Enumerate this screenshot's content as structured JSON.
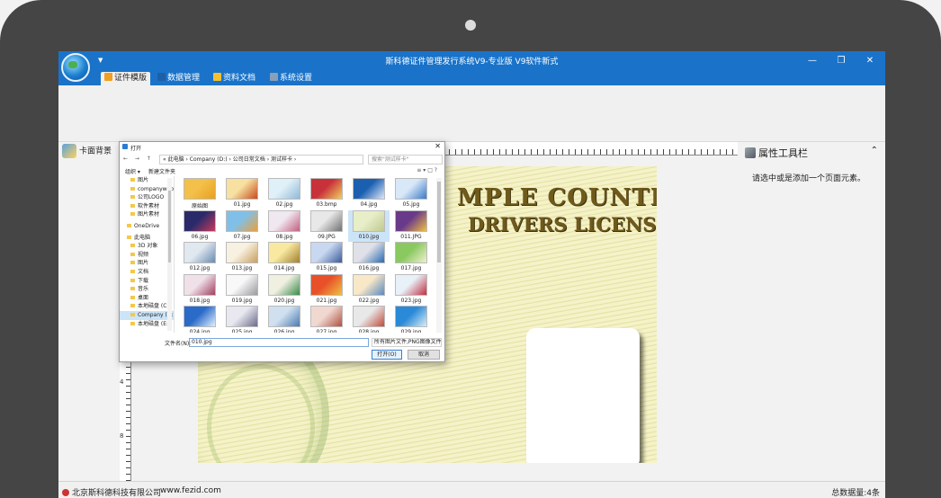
{
  "app": {
    "title": "斯科德证件管理发行系统V9-专业版    V9软件新式",
    "window_controls": {
      "minimize": "—",
      "restore": "❐",
      "close": "✕"
    }
  },
  "ribbon": {
    "tabs": [
      {
        "label": "证件模版",
        "color": "#f0a020"
      },
      {
        "label": "数据管理",
        "color": "#1e5fa8"
      },
      {
        "label": "资料文档",
        "color": "#f5c030"
      },
      {
        "label": "系统设置",
        "color": "#8aa0b8"
      }
    ],
    "orb_arrow": "▼"
  },
  "left_panel": {
    "card_background_label": "卡面背景"
  },
  "canvas": {
    "card_title_1": "MPLE COUNTRY",
    "card_title_2": "DRIVERS LICENSE",
    "ruler_v_labels": [
      "4",
      "8"
    ],
    "more_dots": "⋮"
  },
  "props_panel": {
    "title": "属性工具栏",
    "collapse": "⌃",
    "hint": "请选中或是添加一个页面元素。"
  },
  "statusbar": {
    "company": "北京斯科德科技有限公司",
    "url": "www.fezid.com",
    "count": "总数据量:4条"
  },
  "dialog": {
    "title": "打开",
    "close": "✕",
    "nav": "← → ↑",
    "address": "« 此电脑  ›  Company (D:)  ›  公司日常文档  ›  测试样卡  ›",
    "search_placeholder": "搜索\"测试样卡\"",
    "organize": "组织 ▾",
    "new_folder": "新建文件夹",
    "view": "≡ ▾  □  ?",
    "sidebar": [
      {
        "label": "图片",
        "cls": "l1"
      },
      {
        "label": "companyweb",
        "cls": "l1"
      },
      {
        "label": "公司LOGO",
        "cls": "l1"
      },
      {
        "label": "软件素材",
        "cls": "l1"
      },
      {
        "label": "图片素材",
        "cls": "l1"
      },
      {
        "label": "OneDrive",
        "cls": "gap"
      },
      {
        "label": "此电脑",
        "cls": "gap"
      },
      {
        "label": "3D 对象",
        "cls": "l1"
      },
      {
        "label": "视频",
        "cls": "l1"
      },
      {
        "label": "图片",
        "cls": "l1"
      },
      {
        "label": "文档",
        "cls": "l1"
      },
      {
        "label": "下载",
        "cls": "l1"
      },
      {
        "label": "音乐",
        "cls": "l1"
      },
      {
        "label": "桌面",
        "cls": "l1"
      },
      {
        "label": "本地磁盘 (C:)",
        "cls": "l1"
      },
      {
        "label": "Company (D:)",
        "cls": "l1 sel"
      },
      {
        "label": "本地磁盘 (E:)",
        "cls": "l1"
      }
    ],
    "files": [
      {
        "name": "原始图",
        "c1": "#f3c04a",
        "c2": "#e8a020"
      },
      {
        "name": "01.jpg",
        "c1": "#f7e0a0",
        "c2": "#c84a1e"
      },
      {
        "name": "02.jpg",
        "c1": "#e0f0f8",
        "c2": "#90b8d8"
      },
      {
        "name": "03.bmp",
        "c1": "#c8303a",
        "c2": "#f0d060"
      },
      {
        "name": "04.jpg",
        "c1": "#1a5fb0",
        "c2": "#e0e8f8"
      },
      {
        "name": "05.jpg",
        "c1": "#d8e8f8",
        "c2": "#3a7ac8"
      },
      {
        "name": "06.jpg",
        "c1": "#2a2a6a",
        "c2": "#c83a5a"
      },
      {
        "name": "07.jpg",
        "c1": "#80c0e8",
        "c2": "#e8a040"
      },
      {
        "name": "08.jpg",
        "c1": "#f0e8f0",
        "c2": "#c06080"
      },
      {
        "name": "09.JPG",
        "c1": "#e8e8e8",
        "c2": "#707070"
      },
      {
        "name": "010.jpg",
        "c1": "#e8eec8",
        "c2": "#c0c890"
      },
      {
        "name": "011.JPG",
        "c1": "#6a3a8a",
        "c2": "#f0c040"
      },
      {
        "name": "012.jpg",
        "c1": "#e0e8f0",
        "c2": "#6a8ab0"
      },
      {
        "name": "013.jpg",
        "c1": "#f8f0e0",
        "c2": "#c8a060"
      },
      {
        "name": "014.jpg",
        "c1": "#f8e8a0",
        "c2": "#a08030"
      },
      {
        "name": "015.jpg",
        "c1": "#c8d8f0",
        "c2": "#3a5a9a"
      },
      {
        "name": "016.jpg",
        "c1": "#e0e0e8",
        "c2": "#2a6ab0"
      },
      {
        "name": "017.jpg",
        "c1": "#8ac860",
        "c2": "#f0f0d0"
      },
      {
        "name": "018.jpg",
        "c1": "#f0e0e8",
        "c2": "#a04060"
      },
      {
        "name": "019.jpg",
        "c1": "#f8f8f8",
        "c2": "#9a9aa0"
      },
      {
        "name": "020.jpg",
        "c1": "#f0f0e0",
        "c2": "#3a8a4a"
      },
      {
        "name": "021.jpg",
        "c1": "#e8502a",
        "c2": "#f0c040"
      },
      {
        "name": "022.jpg",
        "c1": "#f8e8c8",
        "c2": "#5a8ac0"
      },
      {
        "name": "023.jpg",
        "c1": "#e8f0f8",
        "c2": "#c03040"
      },
      {
        "name": "024.jpg",
        "c1": "#2a6ac8",
        "c2": "#e0f0ff"
      },
      {
        "name": "025.jpg",
        "c1": "#e8e8f0",
        "c2": "#6a6a8a"
      },
      {
        "name": "026.jpg",
        "c1": "#d0e0f0",
        "c2": "#4a7ab0"
      },
      {
        "name": "027.jpg",
        "c1": "#f0d8d0",
        "c2": "#b05040"
      },
      {
        "name": "028.jpg",
        "c1": "#e8e8e8",
        "c2": "#c04a3a"
      },
      {
        "name": "029.jpg",
        "c1": "#2a8ad8",
        "c2": "#d8eef8"
      }
    ],
    "filename_label": "文件名(N):",
    "filename_value": "010.jpg",
    "filetype": "所有图片文件,PNG图像文件,JPEG... ▾",
    "open_label": "打开(O)",
    "cancel_label": "取消"
  }
}
